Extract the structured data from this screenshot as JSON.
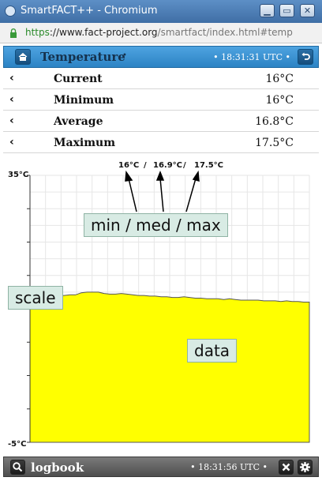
{
  "window": {
    "title": "SmartFACT++ - Chromium",
    "url_scheme": "https",
    "url_host": "://www.fact-project.org",
    "url_path": "/smartfact/index.html#temp"
  },
  "header": {
    "title": "Temperature",
    "title_marker": "•",
    "time": "• 18:31:31 UTC •"
  },
  "stats": [
    {
      "label": "Current",
      "value": "16°C"
    },
    {
      "label": "Minimum",
      "value": "16°C"
    },
    {
      "label": "Average",
      "value": "16.8°C"
    },
    {
      "label": "Maximum",
      "value": "17.5°C"
    }
  ],
  "chart_data": {
    "type": "area",
    "title": "",
    "top_annotation": [
      "16°C",
      "16.9°C",
      "17.5°C"
    ],
    "top_separator": "/",
    "y_max_label": "35°C",
    "y_min_label": "-5°C",
    "ylim": [
      -5,
      35
    ],
    "grid": true,
    "fill_color": "#ffff00",
    "x": [
      0,
      1,
      2,
      3,
      4,
      5,
      6,
      7,
      8,
      9,
      10,
      11,
      12,
      13,
      14,
      15,
      16,
      17,
      18,
      19,
      20,
      21,
      22,
      23,
      24,
      25,
      26,
      27,
      28,
      29,
      30,
      31,
      32,
      33,
      34,
      35,
      36,
      37,
      38,
      39,
      40,
      41,
      42,
      43,
      44,
      45,
      46,
      47,
      48,
      49
    ],
    "values": [
      16.9,
      16.9,
      17.0,
      17.1,
      17.1,
      17.0,
      17.0,
      17.1,
      17.1,
      17.4,
      17.5,
      17.5,
      17.5,
      17.3,
      17.2,
      17.2,
      17.3,
      17.2,
      17.1,
      17.0,
      17.0,
      16.9,
      16.9,
      16.8,
      16.8,
      16.7,
      16.7,
      16.8,
      16.7,
      16.6,
      16.6,
      16.5,
      16.5,
      16.5,
      16.4,
      16.5,
      16.4,
      16.3,
      16.3,
      16.3,
      16.3,
      16.2,
      16.2,
      16.2,
      16.1,
      16.2,
      16.1,
      16.1,
      16.0,
      16.0
    ]
  },
  "annotations": {
    "min_med_max": "min / med / max",
    "scale": "scale",
    "data": "data"
  },
  "footer": {
    "title": "logbook",
    "time": "• 18:31:56 UTC •"
  },
  "icons": {
    "home": "home-icon",
    "back": "back-icon",
    "search": "search-icon",
    "close": "close-icon",
    "settings": "gear-icon"
  }
}
